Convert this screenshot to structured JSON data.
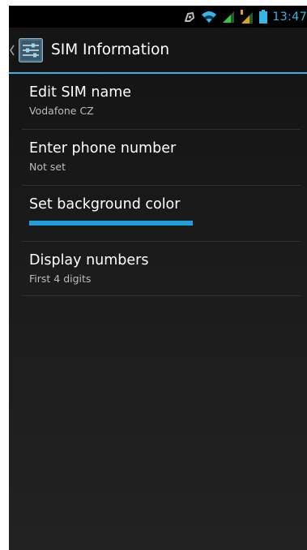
{
  "status_bar": {
    "time": "13:47",
    "icons": [
      "sync-icon",
      "wifi-icon",
      "signal-icon",
      "signal-roaming-icon",
      "battery-icon"
    ]
  },
  "action_bar": {
    "up_icon": "chevron-left-icon",
    "app_icon": "settings-sliders-icon",
    "title": "SIM Information"
  },
  "settings": {
    "items": [
      {
        "title": "Edit SIM name",
        "summary": "Vodafone CZ"
      },
      {
        "title": "Enter phone number",
        "summary": "Not set"
      },
      {
        "title": "Set background color",
        "color": "#1e9fdb"
      },
      {
        "title": "Display numbers",
        "summary": "First 4 digits"
      }
    ]
  },
  "colors": {
    "accent": "#33b5e5",
    "background": "#1a1a1a"
  }
}
